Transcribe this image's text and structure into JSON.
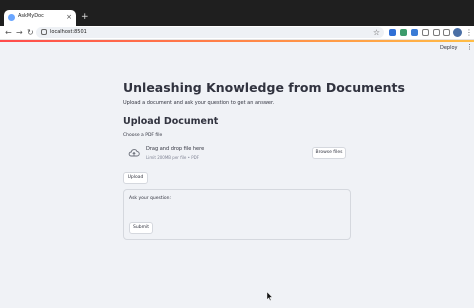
{
  "browser": {
    "tab_title": "AskMyDoc",
    "tab_close": "×",
    "new_tab": "+",
    "back": "←",
    "forward": "→",
    "reload": "↻",
    "url": "localhost:8501",
    "star": "☆",
    "menu": "⋮",
    "extension_colors": [
      "#2f6fd6",
      "#3c9b6b",
      "#3a7bd5",
      "#7a7a7a",
      "#7a7a7a",
      "#7a7a7a"
    ]
  },
  "app": {
    "deploy_label": "Deploy",
    "menu": "⋮",
    "title": "Unleashing Knowledge from Documents",
    "subtitle": "Upload a document and ask your question to get an answer.",
    "upload_section_title": "Upload Document",
    "file_label": "Choose a PDF file",
    "dropzone_title": "Drag and drop file here",
    "dropzone_limit": "Limit 200MB per file • PDF",
    "browse_label": "Browse files",
    "upload_label": "Upload",
    "question_label": "Ask your question:",
    "submit_label": "Submit"
  },
  "icons": {
    "favicon": "streamlit-favicon",
    "upload": "cloud-upload-icon",
    "cursor": "mouse-pointer-icon"
  },
  "colors": {
    "accent_gradient_start": "#ff4b4b",
    "accent_gradient_end": "#ffbd45",
    "background": "#f0f2f6",
    "text": "#31333f"
  }
}
